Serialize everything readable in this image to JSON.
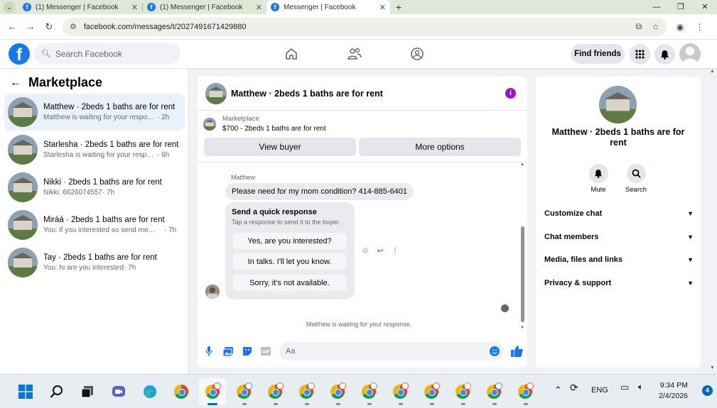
{
  "browser": {
    "tabs": [
      {
        "title": "(1) Messenger | Facebook"
      },
      {
        "title": "(1) Messenger | Facebook"
      },
      {
        "title": "Messenger | Facebook"
      }
    ],
    "url": "facebook.com/messages/t/2027491671429880"
  },
  "fb_header": {
    "search_placeholder": "Search Facebook",
    "find_friends": "Find friends"
  },
  "sidebar": {
    "title": "Marketplace",
    "conversations": [
      {
        "name": "Matthew · 2beds 1 baths are for rent",
        "preview": "Matthew is waiting for your response.",
        "time": "· 2h"
      },
      {
        "name": "Starlesha · 2beds 1 baths are for rent",
        "preview": "Starlesha is waiting for your response.",
        "time": "· 6h"
      },
      {
        "name": "Nikki · 2beds 1 baths are for rent",
        "preview": "Nikki: 6626074557",
        "time": "· 7h"
      },
      {
        "name": "Miráá · 2beds 1 baths are for rent",
        "preview": "You: if you interested so send me nu...",
        "time": "· 7h"
      },
      {
        "name": "Tay · 2beds 1 baths are for rent",
        "preview": "You: hi are you interested",
        "time": "· 7h"
      }
    ]
  },
  "chat": {
    "title": "Matthew · 2beds 1 baths are for rent",
    "info_icon": "i",
    "marketplace_label": "Marketplace",
    "listing": "$700 - 2beds 1 baths are for rent",
    "view_buyer": "View buyer",
    "more_options": "More options",
    "sender": "Matthew",
    "message": "Please need for my mom condition? 414-885-6401",
    "quick_title": "Send a quick response",
    "quick_subtitle": "Tap a response to send it to the buyer.",
    "quick_responses": [
      "Yes, are you interested?",
      "In talks. I'll let you know.",
      "Sorry, it's not available."
    ],
    "waiting_note": "Matthew is waiting for your response.",
    "composer_placeholder": "Aa"
  },
  "details": {
    "name": "Matthew · 2beds 1 baths are for rent",
    "mute": "Mute",
    "search": "Search",
    "sections": [
      "Customize chat",
      "Chat members",
      "Media, files and links",
      "Privacy & support"
    ]
  },
  "taskbar": {
    "language": "ENG",
    "time": "9:34 PM",
    "date": "2/4/2026",
    "notifications": "4"
  },
  "colors": {
    "fb_blue": "#1877f2",
    "active_conversation": "#ebf1fb",
    "info_purple": "#a10ed3"
  }
}
